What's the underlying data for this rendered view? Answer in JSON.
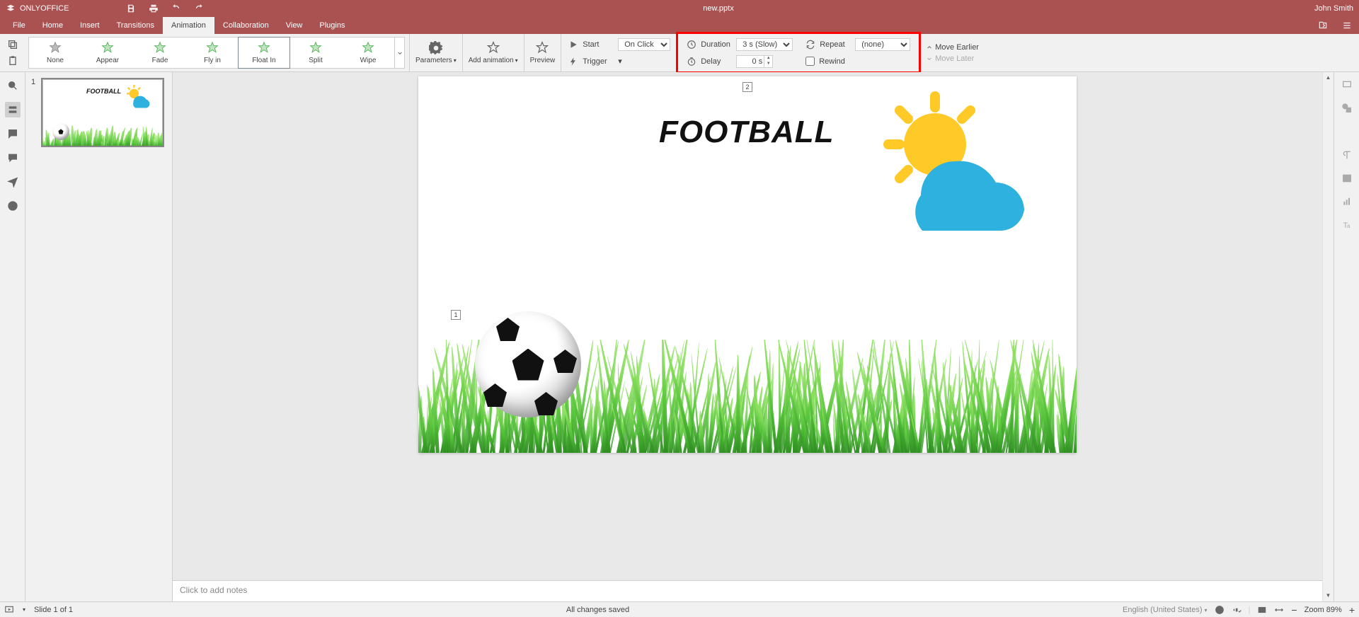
{
  "app": {
    "brand": "ONLYOFFICE",
    "doc_title": "new.pptx",
    "user": "John Smith"
  },
  "tabs": {
    "file": "File",
    "home": "Home",
    "insert": "Insert",
    "transitions": "Transitions",
    "animation": "Animation",
    "collaboration": "Collaboration",
    "view": "View",
    "plugins": "Plugins"
  },
  "gallery": {
    "items": [
      {
        "label": "None",
        "color": "#888"
      },
      {
        "label": "Appear",
        "color": "#4caf50"
      },
      {
        "label": "Fade",
        "color": "#4caf50"
      },
      {
        "label": "Fly in",
        "color": "#4caf50"
      },
      {
        "label": "Float In",
        "color": "#4caf50"
      },
      {
        "label": "Split",
        "color": "#4caf50"
      },
      {
        "label": "Wipe",
        "color": "#4caf50"
      }
    ]
  },
  "ribbon": {
    "parameters": "Parameters",
    "add_animation": "Add animation",
    "preview": "Preview",
    "start_label": "Start",
    "trigger_label": "Trigger",
    "duration_label": "Duration",
    "delay_label": "Delay",
    "repeat_label": "Repeat",
    "rewind_label": "Rewind",
    "move_earlier": "Move Earlier",
    "move_later": "Move Later",
    "start_value": "On Click",
    "duration_value": "3 s (Slow)",
    "delay_value": "0 s",
    "repeat_value": "(none)"
  },
  "slide": {
    "headline": "FOOTBALL",
    "badge_top": "2",
    "badge_left": "1"
  },
  "thumb": {
    "index": "1",
    "headline": "FOOTBALL"
  },
  "notes": {
    "placeholder": "Click to add notes"
  },
  "status": {
    "slide_info": "Slide 1 of 1",
    "save_state": "All changes saved",
    "language": "English (United States)",
    "zoom_label": "Zoom 89%"
  }
}
